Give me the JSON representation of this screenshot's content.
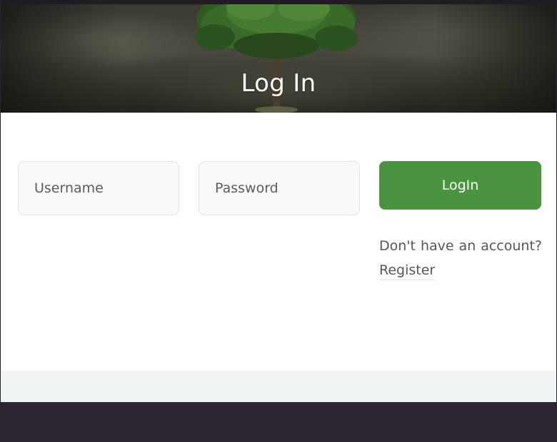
{
  "page": {
    "title": "Log In"
  },
  "form": {
    "username_placeholder": "Username",
    "password_placeholder": "Password",
    "login_label": "LogIn",
    "register_prompt": "Don't have an account?",
    "register_link": "Register"
  },
  "colors": {
    "accent": "#4a933f",
    "footer": "#2a2530",
    "band": "#eff3f3"
  }
}
